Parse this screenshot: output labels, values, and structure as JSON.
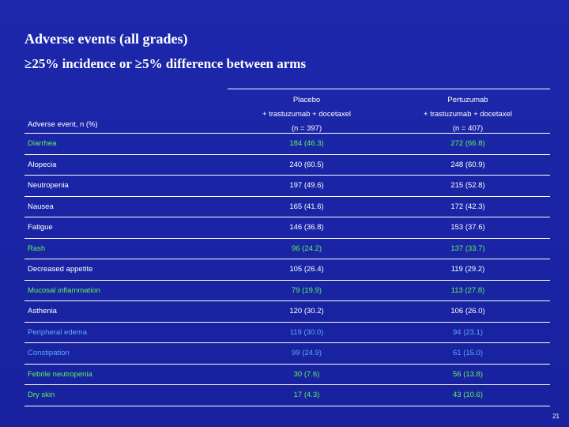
{
  "slide": {
    "title": "Adverse events (all grades)",
    "subtitle": "≥25% incidence or ≥5% difference between arms",
    "page_number": "21"
  },
  "table": {
    "event_header": "Adverse event, n (%)",
    "columns": [
      {
        "line1": "Placebo",
        "line2": "+ trastuzumab + docetaxel",
        "line3": "(n = 397)"
      },
      {
        "line1": "Pertuzumab",
        "line2": "+ trastuzumab + docetaxel",
        "line3": "(n = 407)"
      }
    ],
    "rows": [
      {
        "event": "Diarrhea",
        "placebo": "184 (46.3)",
        "pertuzumab": "272 (66.8)",
        "highlight": "green"
      },
      {
        "event": "Alopecia",
        "placebo": "240 (60.5)",
        "pertuzumab": "248 (60.9)",
        "highlight": "none"
      },
      {
        "event": "Neutropenia",
        "placebo": "197 (49.6)",
        "pertuzumab": "215 (52.8)",
        "highlight": "none"
      },
      {
        "event": "Nausea",
        "placebo": "165 (41.6)",
        "pertuzumab": "172 (42.3)",
        "highlight": "none"
      },
      {
        "event": "Fatigue",
        "placebo": "146 (36.8)",
        "pertuzumab": "153 (37.6)",
        "highlight": "none"
      },
      {
        "event": "Rash",
        "placebo": "96 (24.2)",
        "pertuzumab": "137 (33.7)",
        "highlight": "green"
      },
      {
        "event": "Decreased appetite",
        "placebo": "105 (26.4)",
        "pertuzumab": "119 (29.2)",
        "highlight": "none"
      },
      {
        "event": "Mucosal inflammation",
        "placebo": "79 (19.9)",
        "pertuzumab": "113 (27.8)",
        "highlight": "green"
      },
      {
        "event": "Asthenia",
        "placebo": "120 (30.2)",
        "pertuzumab": "106 (26.0)",
        "highlight": "none"
      },
      {
        "event": "Peripheral edema",
        "placebo": "119 (30.0)",
        "pertuzumab": "94 (23.1)",
        "highlight": "blue"
      },
      {
        "event": "Constipation",
        "placebo": "99 (24.9)",
        "pertuzumab": "61 (15.0)",
        "highlight": "blue"
      },
      {
        "event": "Febrile neutropenia",
        "placebo": "30 (7.6)",
        "pertuzumab": "56 (13.8)",
        "highlight": "green"
      },
      {
        "event": "Dry skin",
        "placebo": "17 (4.3)",
        "pertuzumab": "43 (10.6)",
        "highlight": "green"
      }
    ]
  },
  "colors": {
    "background": "#1a23a3",
    "text": "#ffffff",
    "green_highlight": "#5cf25c",
    "blue_highlight": "#5aa8ff"
  }
}
